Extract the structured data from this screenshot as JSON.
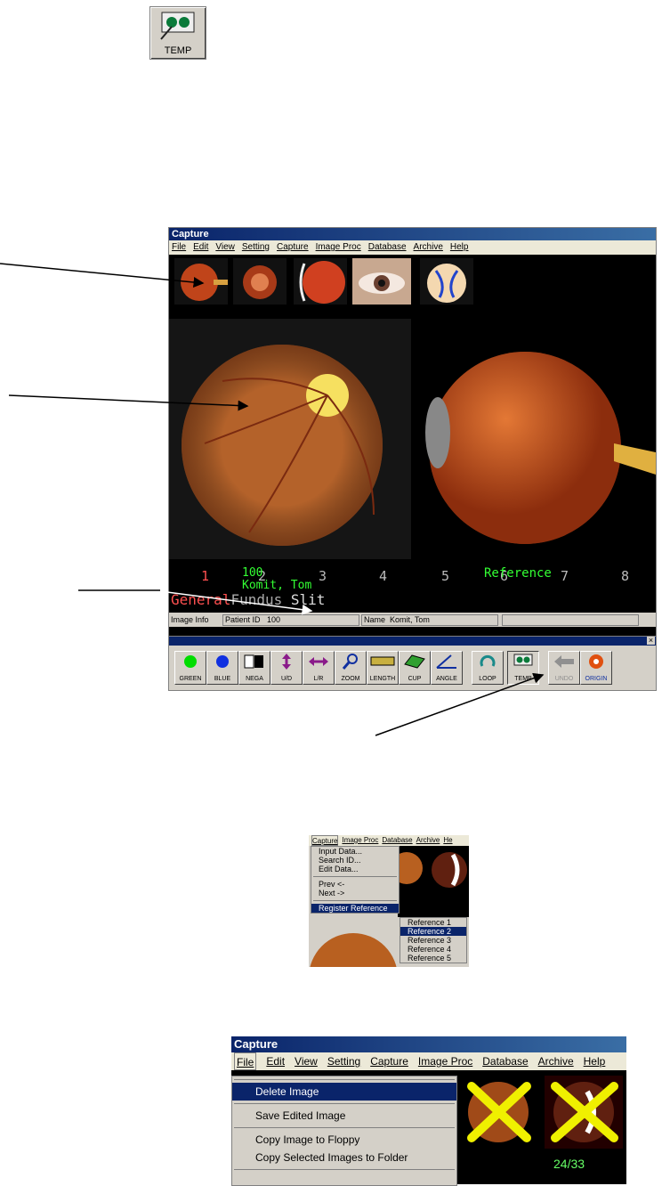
{
  "temp_icon": {
    "label": "TEMP"
  },
  "main_window": {
    "title": "Capture",
    "menus": [
      "File",
      "Edit",
      "View",
      "Setting",
      "Capture",
      "Image Proc",
      "Database",
      "Archive",
      "Help"
    ],
    "slot_numbers": [
      "1",
      "2",
      "3",
      "4",
      "5",
      "6",
      "7",
      "8"
    ],
    "patient_id_overlay": "100",
    "patient_name_overlay": "Komit, Tom",
    "reference_label": "Reference",
    "mode_labels": {
      "general": "General",
      "fundus": "Fundus",
      "slit": "Slit"
    },
    "status": {
      "image_info": "Image Info",
      "patient_id_label": "Patient ID",
      "patient_id_value": "100",
      "name_label": "Name",
      "name_value": "Komit, Tom"
    }
  },
  "toolbar": {
    "buttons": [
      {
        "label": "GREEN"
      },
      {
        "label": "BLUE"
      },
      {
        "label": "NEGA"
      },
      {
        "label": "U/D"
      },
      {
        "label": "L/R"
      },
      {
        "label": "ZOOM"
      },
      {
        "label": "LENGTH"
      },
      {
        "label": "CUP"
      },
      {
        "label": "ANGLE"
      },
      {
        "label": "LOOP"
      },
      {
        "label": "TEMP"
      },
      {
        "label": "UNDO"
      },
      {
        "label": "ORIGIN"
      }
    ],
    "close_glyph": "×"
  },
  "capture_menu": {
    "menus": [
      "Capture",
      "Image Proc",
      "Database",
      "Archive",
      "He"
    ],
    "items": [
      "Input Data...",
      "Search ID...",
      "Edit Data...",
      "Prev <-",
      "Next ->",
      "Register Reference"
    ],
    "submenu": [
      "Reference 1",
      "Reference 2",
      "Reference 3",
      "Reference 4",
      "Reference 5"
    ]
  },
  "file_menu_window": {
    "title": "Capture",
    "menus": [
      "File",
      "Edit",
      "View",
      "Setting",
      "Capture",
      "Image Proc",
      "Database",
      "Archive",
      "Help"
    ],
    "items": [
      "Delete Image",
      "Save Edited Image",
      "Copy Image to Floppy",
      "Copy Selected Images to Folder"
    ],
    "counter": "24/33"
  },
  "colors": {
    "title_bar": "#0a246a",
    "selection": "#0a246a",
    "overlay_green": "#33ff33",
    "overlay_red": "#ff4444"
  }
}
